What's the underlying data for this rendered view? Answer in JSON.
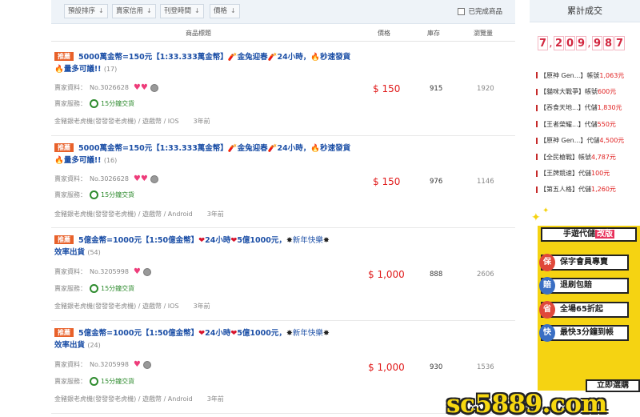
{
  "sort_bar": {
    "buttons": [
      "預設排序",
      "賣家信用",
      "刊登時間",
      "價格"
    ],
    "arrow": "↓",
    "completed_checkbox_label": "已完成商品",
    "completed_checked": false
  },
  "table_header": {
    "title_col": "商品標題",
    "price_col": "價格",
    "stock_col": "庫存",
    "views_col": "瀏覽量"
  },
  "labels": {
    "seller_info": "賣家資料：",
    "seller_service": "賣家服務：",
    "delivery": "15分鐘交貨",
    "badge": "推薦"
  },
  "listings": [
    {
      "title_a": "5000萬金幣=150元【1:33.333萬金幣】",
      "title_b": "金兔迎春",
      "title_c": "24小時，",
      "title_d": "秒速發貨",
      "title_e": "量多可議!!",
      "count": "(17)",
      "seller_no": "No.3026628",
      "hearts": "♥♥",
      "price": "$ 150",
      "stock": "915",
      "views": "1920",
      "category": "金豬銀老虎機(發發發老虎機) / 遊戲幣 / IOS",
      "ago": "3年前"
    },
    {
      "title_a": "5000萬金幣=150元【1:33.333萬金幣】",
      "title_b": "金兔迎春",
      "title_c": "24小時，",
      "title_d": "秒速發貨",
      "title_e": "量多可議!!",
      "count": "(16)",
      "seller_no": "No.3026628",
      "hearts": "♥♥",
      "price": "$ 150",
      "stock": "976",
      "views": "1146",
      "category": "金豬銀老虎機(發發發老虎機) / 遊戲幣 / Android",
      "ago": "3年前"
    },
    {
      "title_a": "5億金幣=1000元【1:50億金幣】",
      "title_b": "24小時",
      "title_c": "5億1000元，",
      "title_d": "新年快樂",
      "title_e": "效率出貨",
      "count": "(54)",
      "seller_no": "No.3205998",
      "hearts": "♥",
      "price": "$ 1,000",
      "stock": "888",
      "views": "2606",
      "category": "金豬銀老虎機(發發發老虎機) / 遊戲幣 / IOS",
      "ago": "3年前"
    },
    {
      "title_a": "5億金幣=1000元【1:50億金幣】",
      "title_b": "24小時",
      "title_c": "5億1000元，",
      "title_d": "新年快樂",
      "title_e": "效率出貨",
      "count": "(24)",
      "seller_no": "No.3205998",
      "hearts": "♥",
      "price": "$ 1,000",
      "stock": "930",
      "views": "1536",
      "category": "金豬銀老虎機(發發發老虎機) / 遊戲幣 / Android",
      "ago": "3年前"
    }
  ],
  "sidebar": {
    "title": "累計成交",
    "counter_digits": [
      "7",
      "2",
      "0",
      "9",
      "9",
      "8",
      "7"
    ],
    "counter_display": "7,209,987",
    "transactions": [
      {
        "game": "【原神 Gen...】",
        "type": "帳號",
        "amount": "1,063元"
      },
      {
        "game": "【貓咪大戰爭】",
        "type": "帳號",
        "amount": "600元"
      },
      {
        "game": "【吞食天地...】",
        "type": "代儲",
        "amount": "1,830元"
      },
      {
        "game": "【王者榮耀...】",
        "type": "代儲",
        "amount": "550元"
      },
      {
        "game": "【原神 Gen...】",
        "type": "代儲",
        "amount": "4,500元"
      },
      {
        "game": "【全民槍戰】",
        "type": "帳號",
        "amount": "4,787元"
      },
      {
        "game": "【王牌競速】",
        "type": "代儲",
        "amount": "100元"
      },
      {
        "game": "【第五人格】",
        "type": "代儲",
        "amount": "1,260元"
      }
    ]
  },
  "ad": {
    "title_a": "手遊代儲",
    "title_b": "改版",
    "items": [
      {
        "badge": "保",
        "text": "保字會員專賣",
        "color": "#e0483a"
      },
      {
        "badge": "賠",
        "text": "退刷包賠",
        "color": "#3a6fc4"
      },
      {
        "badge": "省",
        "text": "全場65折起",
        "color": "#e0483a"
      },
      {
        "badge": "快",
        "text": "最快3分鐘到帳",
        "color": "#3a6fc4"
      }
    ],
    "cta": "立即選購"
  },
  "watermark": "sc5889.com"
}
